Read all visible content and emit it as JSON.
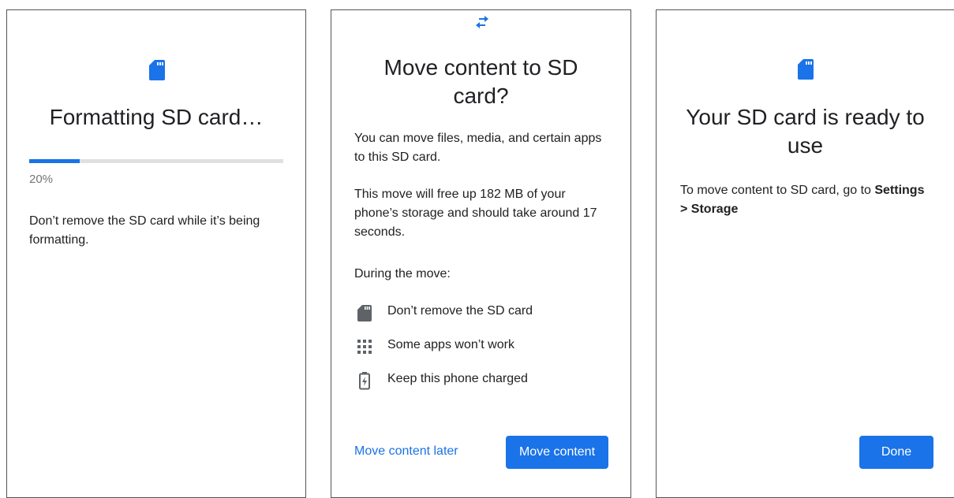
{
  "colors": {
    "accent": "#1a73e8",
    "icon_gray": "#5f6368",
    "text": "#202124",
    "muted": "#757575"
  },
  "screen1": {
    "icon": "sd-card-icon",
    "title": "Formatting SD card…",
    "progress": {
      "percent": 20,
      "label": "20%"
    },
    "message": "Don’t remove the SD card while it’s being formatting."
  },
  "screen2": {
    "icon": "swap-arrows-icon",
    "title": "Move content to SD card?",
    "paragraph1": "You can move files, media, and certain apps to this SD card.",
    "paragraph2": "This move will free up 182 MB of your phone’s storage and should take around 17 seconds.",
    "paragraph3": "During the move:",
    "list": [
      {
        "icon": "sd-card-icon",
        "label": "Don’t remove the SD card"
      },
      {
        "icon": "apps-grid-icon",
        "label": "Some apps won’t work"
      },
      {
        "icon": "battery-charging-icon",
        "label": "Keep this phone charged"
      }
    ],
    "secondary_button": "Move content later",
    "primary_button": "Move content"
  },
  "screen3": {
    "icon": "sd-card-icon",
    "title": "Your SD card is ready to use",
    "message_prefix": "To move content to SD card, go to ",
    "message_bold1": "Settings",
    "message_bold2": "> Storage",
    "primary_button": "Done"
  }
}
